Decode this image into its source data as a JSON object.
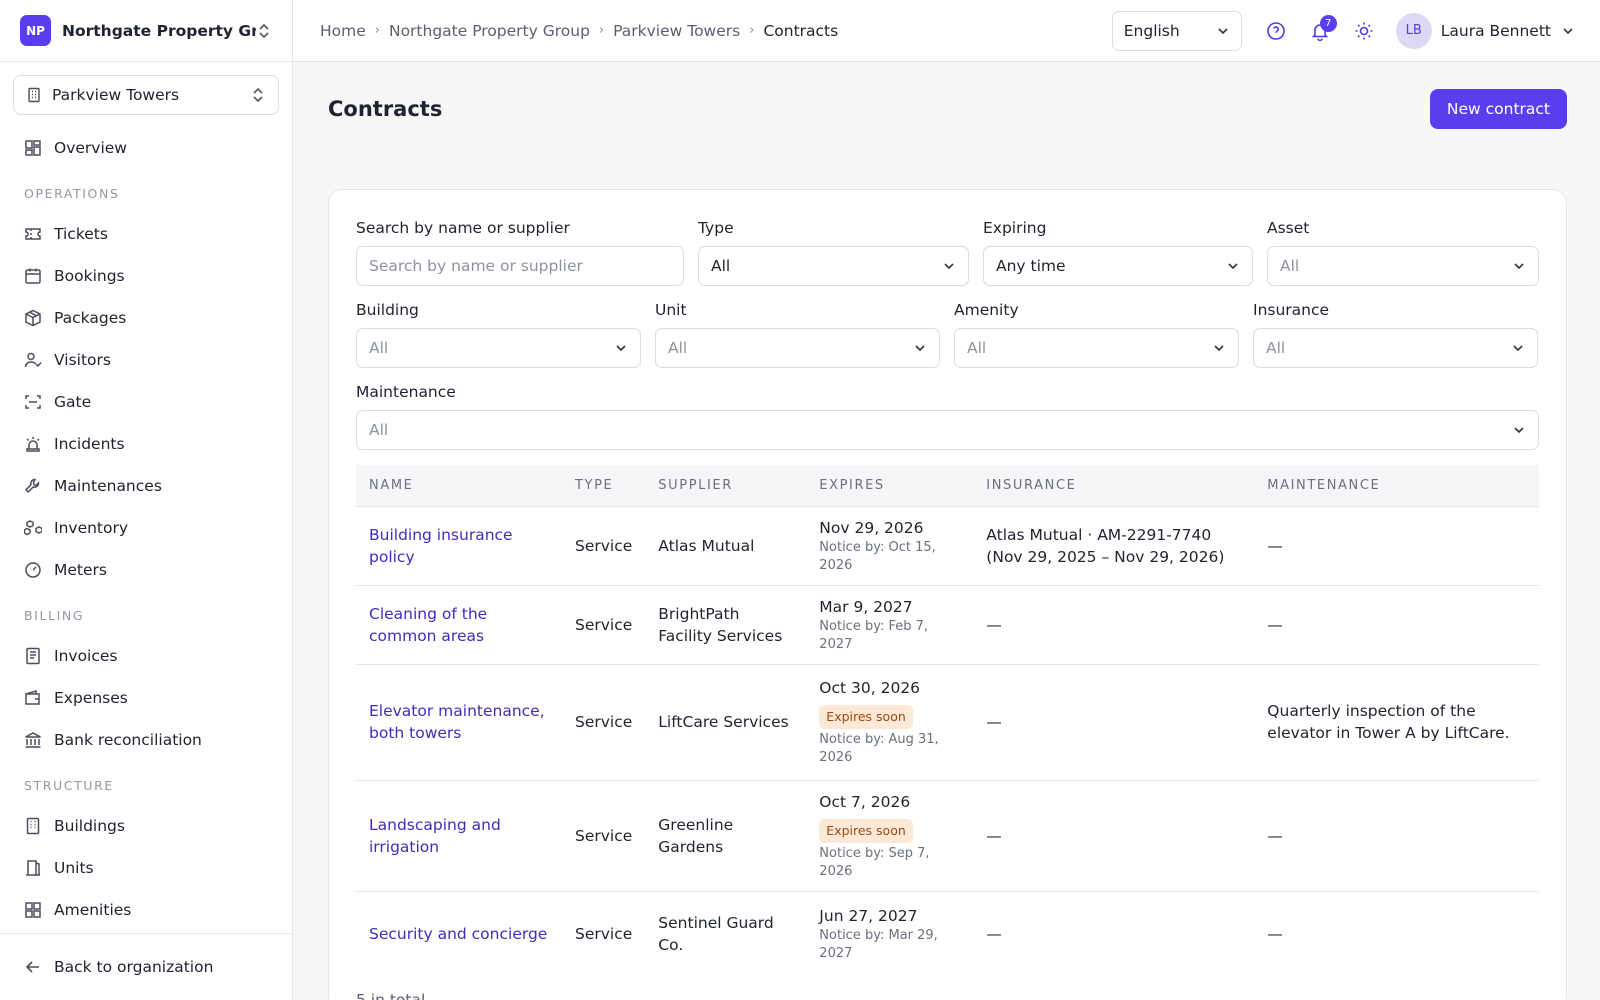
{
  "org": {
    "initials": "NP",
    "name": "Northgate Property Gr..."
  },
  "building_selector": {
    "label": "Parkview Towers"
  },
  "sidebar": {
    "overview": "Overview",
    "operations_title": "OPERATIONS",
    "operations": [
      "Tickets",
      "Bookings",
      "Packages",
      "Visitors",
      "Gate",
      "Incidents",
      "Maintenances",
      "Inventory",
      "Meters"
    ],
    "billing_title": "BILLING",
    "billing": [
      "Invoices",
      "Expenses",
      "Bank reconciliation"
    ],
    "structure_title": "STRUCTURE",
    "structure": [
      "Buildings",
      "Units",
      "Amenities"
    ],
    "back": "Back to organization"
  },
  "breadcrumb": [
    "Home",
    "Northgate Property Group",
    "Parkview Towers",
    "Contracts"
  ],
  "topbar": {
    "language": "English",
    "notifications": "7",
    "user_initials": "LB",
    "user_name": "Laura Bennett"
  },
  "page": {
    "title": "Contracts",
    "new_button": "New contract"
  },
  "filters": {
    "search_label": "Search by name or supplier",
    "search_placeholder": "Search by name or supplier",
    "type_label": "Type",
    "type_value": "All",
    "expiring_label": "Expiring",
    "expiring_value": "Any time",
    "asset_label": "Asset",
    "asset_value": "All",
    "building_label": "Building",
    "building_value": "All",
    "unit_label": "Unit",
    "unit_value": "All",
    "amenity_label": "Amenity",
    "amenity_value": "All",
    "insurance_label": "Insurance",
    "insurance_value": "All",
    "maintenance_label": "Maintenance",
    "maintenance_value": "All"
  },
  "table": {
    "headers": [
      "NAME",
      "TYPE",
      "SUPPLIER",
      "EXPIRES",
      "INSURANCE",
      "MAINTENANCE"
    ],
    "rows": [
      {
        "name": "Building insurance policy",
        "type": "Service",
        "supplier": "Atlas Mutual",
        "expires": "Nov 29, 2026",
        "badge": "",
        "notice": "Notice by: Oct 15, 2026",
        "insurance": "Atlas Mutual · AM-2291-7740 (Nov 29, 2025 – Nov 29, 2026)",
        "maintenance": "—"
      },
      {
        "name": "Cleaning of the common areas",
        "type": "Service",
        "supplier": "BrightPath Facility Services",
        "expires": "Mar 9, 2027",
        "badge": "",
        "notice": "Notice by: Feb 7, 2027",
        "insurance": "—",
        "maintenance": "—"
      },
      {
        "name": "Elevator maintenance, both towers",
        "type": "Service",
        "supplier": "LiftCare Services",
        "expires": "Oct 30, 2026",
        "badge": "Expires soon",
        "notice": "Notice by: Aug 31, 2026",
        "insurance": "—",
        "maintenance": "Quarterly inspection of the elevator in Tower A by LiftCare."
      },
      {
        "name": "Landscaping and irrigation",
        "type": "Service",
        "supplier": "Greenline Gardens",
        "expires": "Oct 7, 2026",
        "badge": "Expires soon",
        "notice": "Notice by: Sep 7, 2026",
        "insurance": "—",
        "maintenance": "—"
      },
      {
        "name": "Security and concierge",
        "type": "Service",
        "supplier": "Sentinel Guard Co.",
        "expires": "Jun 27, 2027",
        "badge": "",
        "notice": "Notice by: Mar 29, 2027",
        "insurance": "—",
        "maintenance": "—"
      }
    ],
    "total": "5 in total"
  },
  "colors": {
    "accent": "#5b3df0",
    "link": "#3d2fb8",
    "badge_bg": "#fde9d6",
    "badge_text": "#9a4a12"
  }
}
